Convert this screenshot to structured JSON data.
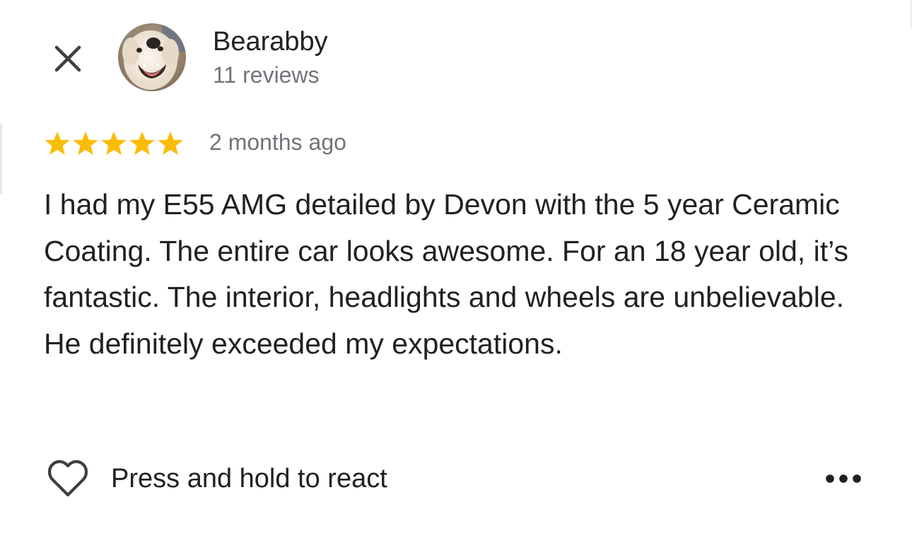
{
  "close": {
    "icon": "close-icon"
  },
  "reviewer": {
    "name": "Bearabby",
    "review_count": "11 reviews",
    "avatar": "dog-avatar"
  },
  "rating": {
    "stars": 5,
    "max_stars": 5,
    "star_color": "#fbbc04",
    "timestamp": "2 months ago"
  },
  "review": {
    "text": "I had my E55 AMG detailed by Devon with the 5 year Ceramic Coating. The entire car looks awesome. For an 18 year old, it’s fantastic. The interior, headlights and wheels are unbelievable. He definitely exceeded my expectations."
  },
  "actions": {
    "react_label": "Press and hold to react",
    "react_icon": "heart-outline-icon",
    "more_icon": "more-horizontal-icon"
  },
  "colors": {
    "text_primary": "#202124",
    "text_secondary": "#70757a"
  }
}
